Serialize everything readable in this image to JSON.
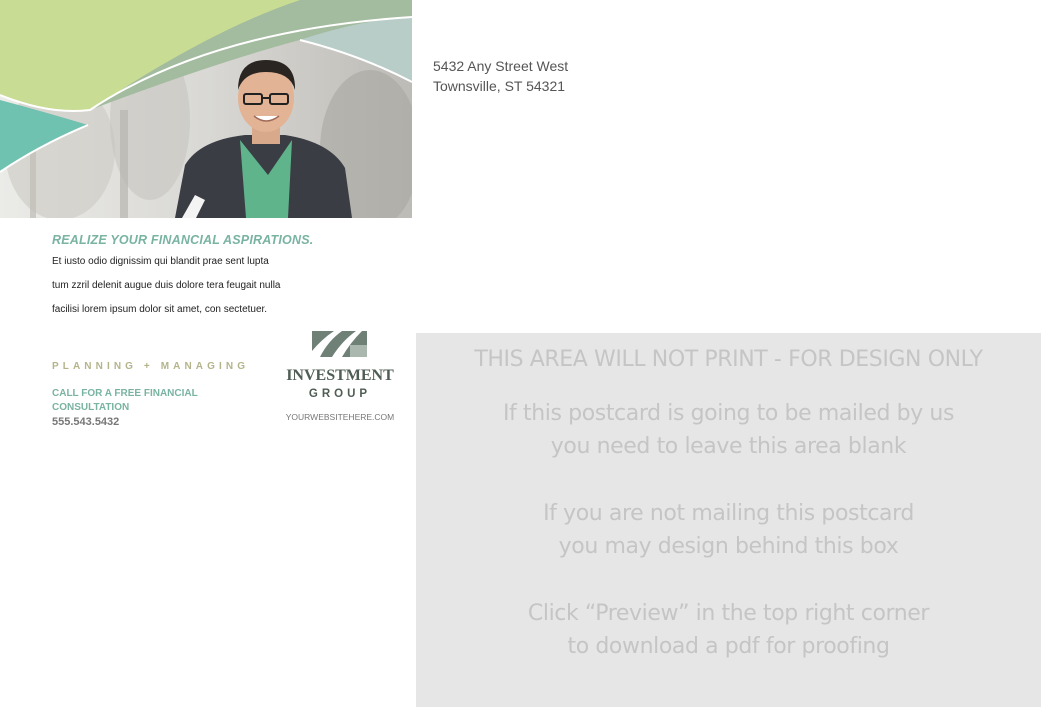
{
  "return_address": {
    "line1": "5432 Any Street West",
    "line2": "Townsville, ST 54321"
  },
  "headline": "REALIZE YOUR FINANCIAL ASPIRATIONS.",
  "body_lines": [
    "Et iusto odio dignissim qui blandit prae sent lupta",
    "tum zzril delenit augue duis dolore tera feugait nulla",
    "facilisi lorem ipsum dolor sit amet, con sectetuer."
  ],
  "tagline": "PLANNING + MANAGING",
  "cta": {
    "line1": "CALL FOR A FREE FINANCIAL",
    "line2": "CONSULTATION",
    "phone": "555.543.5432"
  },
  "logo": {
    "name": "INVESTMENT",
    "sub": "GROUP",
    "website": "YOURWEBSITEHERE.COM"
  },
  "noprint": {
    "title": "THIS AREA WILL NOT PRINT -  FOR DESIGN ONLY",
    "lines": [
      "If this postcard is going to be mailed by us",
      "you need to leave this area blank",
      "If you are not mailing this postcard",
      "you may design behind this box",
      "Click “Preview” in the top right corner",
      "to download a pdf for proofing"
    ]
  },
  "colors": {
    "accent_teal": "#79b3a2",
    "tagline_khaki": "#b4b48c",
    "logo_dark": "#4f5d54",
    "lime": "#c9dc93",
    "sage": "#a3bb9e",
    "mint": "#6fc1b0",
    "noprint_bg": "#e6e6e6"
  }
}
